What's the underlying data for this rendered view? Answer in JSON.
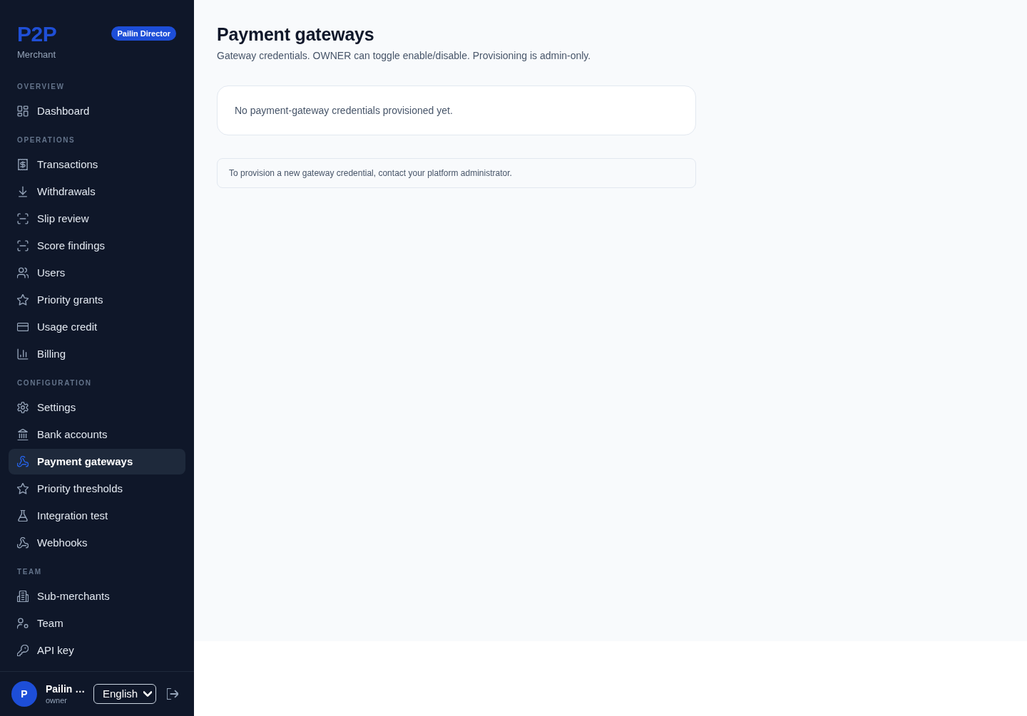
{
  "sidebar": {
    "logo": "P2P",
    "subtitle": "Merchant",
    "role_badge": "Pailin Director",
    "sections": [
      {
        "heading": "OVERVIEW",
        "items": [
          {
            "label": "Dashboard",
            "selected": false
          }
        ]
      },
      {
        "heading": "OPERATIONS",
        "items": [
          {
            "label": "Transactions",
            "selected": false
          },
          {
            "label": "Withdrawals",
            "selected": false
          },
          {
            "label": "Slip review",
            "selected": false
          },
          {
            "label": "Score findings",
            "selected": false
          },
          {
            "label": "Users",
            "selected": false
          },
          {
            "label": "Priority grants",
            "selected": false
          },
          {
            "label": "Usage credit",
            "selected": false
          },
          {
            "label": "Billing",
            "selected": false
          }
        ]
      },
      {
        "heading": "CONFIGURATION",
        "items": [
          {
            "label": "Settings",
            "selected": false
          },
          {
            "label": "Bank accounts",
            "selected": false
          },
          {
            "label": "Payment gateways",
            "selected": true
          },
          {
            "label": "Priority thresholds",
            "selected": false
          },
          {
            "label": "Integration test",
            "selected": false
          },
          {
            "label": "Webhooks",
            "selected": false
          }
        ]
      },
      {
        "heading": "TEAM",
        "items": [
          {
            "label": "Sub-merchants",
            "selected": false
          },
          {
            "label": "Team",
            "selected": false
          },
          {
            "label": "API key",
            "selected": false
          }
        ]
      }
    ],
    "user": {
      "avatar": "P",
      "name": "Pailin …",
      "role": "owner"
    },
    "language": "English"
  },
  "page": {
    "title": "Payment gateways",
    "subtitle": "Gateway credentials. OWNER can toggle enable/disable. Provisioning is admin-only.",
    "empty_message": "No payment-gateway credentials provisioned yet.",
    "note": "To provision a new gateway credential, contact your platform administrator."
  }
}
